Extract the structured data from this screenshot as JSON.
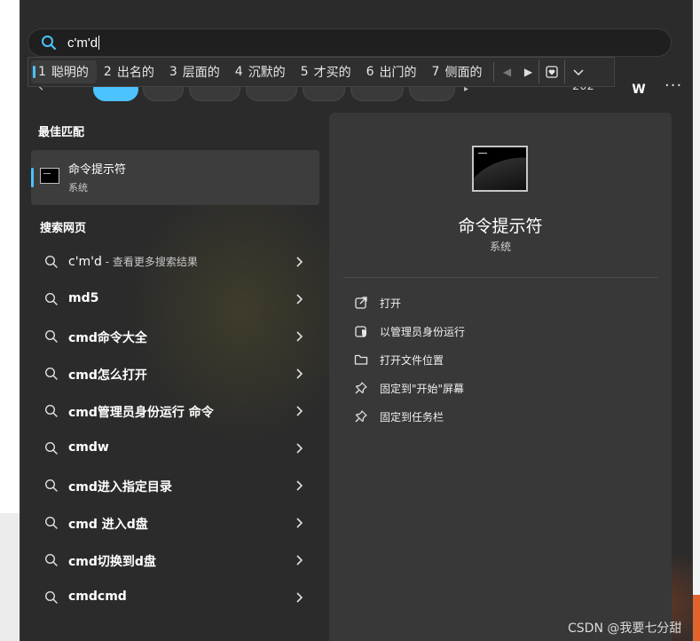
{
  "search": {
    "value": "c'm'd"
  },
  "ime": {
    "candidates": [
      {
        "num": "1",
        "word": "聪明的"
      },
      {
        "num": "2",
        "word": "出名的"
      },
      {
        "num": "3",
        "word": "层面的"
      },
      {
        "num": "4",
        "word": "沉默的"
      },
      {
        "num": "5",
        "word": "才买的"
      },
      {
        "num": "6",
        "word": "出门的"
      },
      {
        "num": "7",
        "word": "侧面的"
      }
    ],
    "accent": "#4cc2ff"
  },
  "topbar": {
    "year_partial": "202",
    "avatar_letter": "W",
    "more_label": "···"
  },
  "best_match": {
    "section_title": "最佳匹配",
    "name": "命令提示符",
    "subtitle": "系统"
  },
  "web": {
    "section_title": "搜索网页",
    "items": [
      {
        "text": "c'm'd",
        "extra": " - 查看更多搜索结果"
      },
      {
        "text": "md5",
        "extra": ""
      },
      {
        "text": "cmd命令大全",
        "extra": ""
      },
      {
        "text": "cmd怎么打开",
        "extra": ""
      },
      {
        "text": "cmd管理员身份运行 命令",
        "extra": ""
      },
      {
        "text": "cmdw",
        "extra": ""
      },
      {
        "text": "cmd进入指定目录",
        "extra": ""
      },
      {
        "text": "cmd 进入d盘",
        "extra": ""
      },
      {
        "text": "cmd切换到d盘",
        "extra": ""
      },
      {
        "text": "cmdcmd",
        "extra": ""
      }
    ]
  },
  "preview": {
    "title": "命令提示符",
    "subtitle": "系统",
    "actions": [
      {
        "label": "打开",
        "icon": "open-icon"
      },
      {
        "label": "以管理员身份运行",
        "icon": "shield-icon"
      },
      {
        "label": "打开文件位置",
        "icon": "folder-icon"
      },
      {
        "label": "固定到\"开始\"屏幕",
        "icon": "pin-icon"
      },
      {
        "label": "固定到任务栏",
        "icon": "pin-icon"
      }
    ]
  },
  "watermark": "CSDN @我要七分甜"
}
